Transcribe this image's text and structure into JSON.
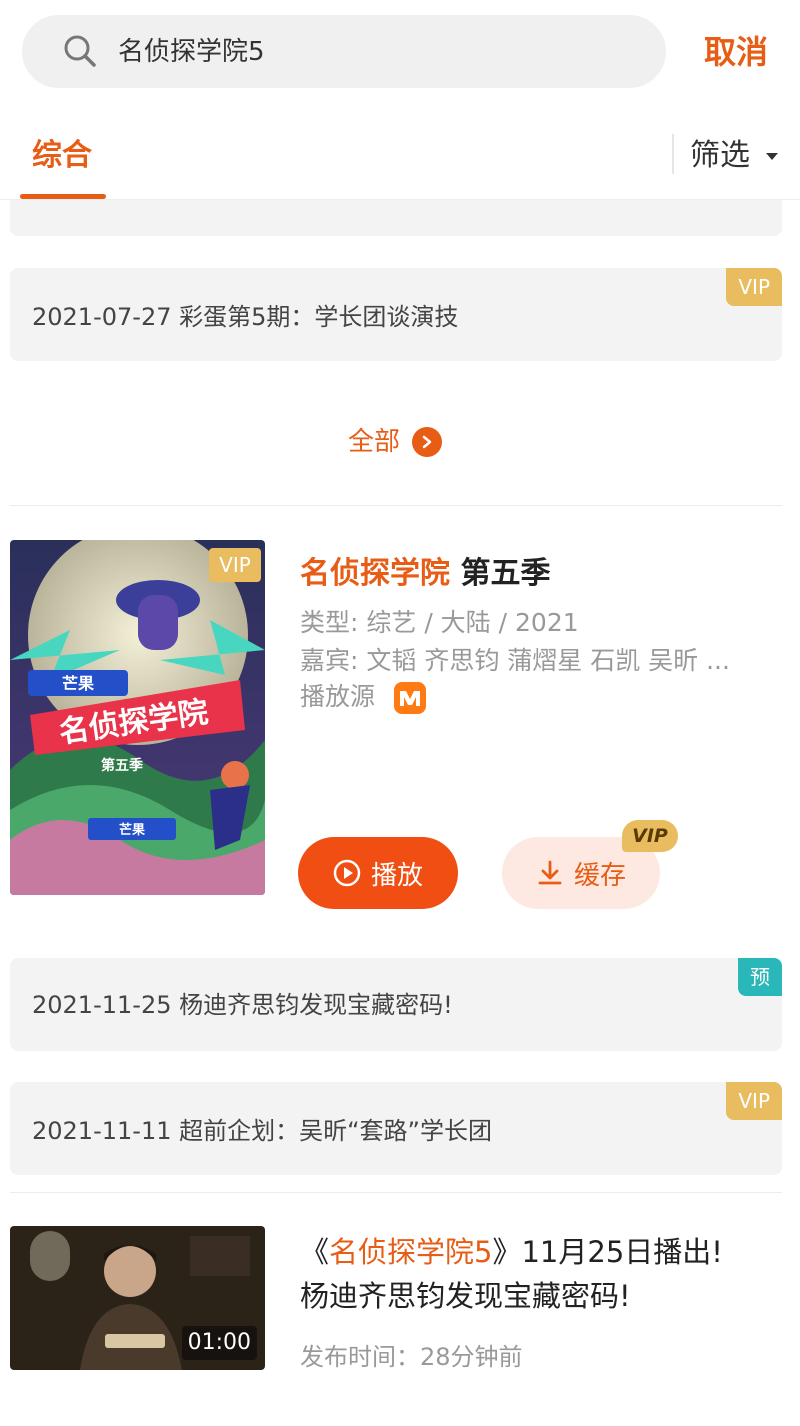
{
  "search": {
    "query": "名侦探学院5",
    "cancel_label": "取消"
  },
  "tabs": {
    "active_label": "综合",
    "filter_label": "筛选"
  },
  "episodes_top": [
    {
      "text": "2021-07-27 彩蛋第5期：学长团谈演技",
      "badge": "VIP"
    }
  ],
  "all_label": "全部",
  "show": {
    "title_highlight": "名侦探学院",
    "title_rest": " 第五季",
    "poster_badge": "VIP",
    "type_line": "类型: 综艺 / 大陆 / 2021",
    "guests_line": "嘉宾: 文韬 齐思钧 蒲熠星 石凯 吴昕 ...",
    "source_label": "播放源",
    "play_label": "播放",
    "cache_label": "缓存",
    "cache_badge": "VIP"
  },
  "episodes_bottom": [
    {
      "text": "2021-11-25 杨迪齐思钧发现宝藏密码!",
      "badge": "预"
    },
    {
      "text": "2021-11-11 超前企划：吴昕“套路”学长团",
      "badge": "VIP"
    }
  ],
  "video": {
    "title_prefix": "《",
    "title_highlight": "名侦探学院5",
    "title_suffix": "》11月25日播出!",
    "title_line2": "杨迪齐思钧发现宝藏密码!",
    "duration": "01:00",
    "publish_time": "发布时间：28分钟前"
  },
  "colors": {
    "accent": "#e85d16",
    "vip": "#e9bd5f",
    "preview": "#2ab7ba"
  }
}
